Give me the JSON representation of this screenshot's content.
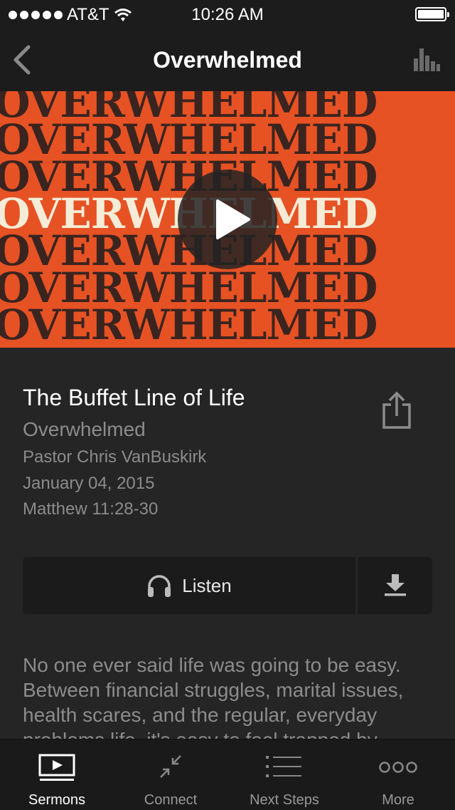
{
  "status_bar": {
    "carrier": "AT&T",
    "time": "10:26 AM",
    "signal_bars": 5,
    "battery_level": 1.0
  },
  "nav": {
    "title": "Overwhelmed",
    "back_icon": "chevron-left-icon",
    "stats_icon": "bar-chart-icon"
  },
  "artwork": {
    "rows": [
      "OVERWHELMED",
      "OVERWHELMED",
      "OVERWHELMED",
      "OVERWHELMED",
      "OVERWHELMED",
      "OVERWHELMED",
      "OVERWHELMED"
    ],
    "highlight_row": 3,
    "colors": {
      "background": "#e65224",
      "text": "#3a2420",
      "highlight": "#f5ecd7"
    }
  },
  "sermon": {
    "title": "The Buffet Line of Life",
    "series": "Overwhelmed",
    "pastor": "Pastor Chris VanBuskirk",
    "date": "January 04, 2015",
    "scripture": "Matthew 11:28-30",
    "description": "No one ever said life was going to be easy. Between financial struggles, marital issues, health scares, and the regular, everyday problems life, it's easy to feel trapped by"
  },
  "actions": {
    "listen_label": "Listen",
    "listen_icon": "headphones-icon",
    "download_icon": "download-icon",
    "share_icon": "share-icon"
  },
  "tabs": [
    {
      "label": "Sermons",
      "icon": "video-play-icon",
      "active": true
    },
    {
      "label": "Connect",
      "icon": "compress-arrows-icon",
      "active": false
    },
    {
      "label": "Next Steps",
      "icon": "list-icon",
      "active": false
    },
    {
      "label": "More",
      "icon": "more-dots-icon",
      "active": false
    }
  ]
}
